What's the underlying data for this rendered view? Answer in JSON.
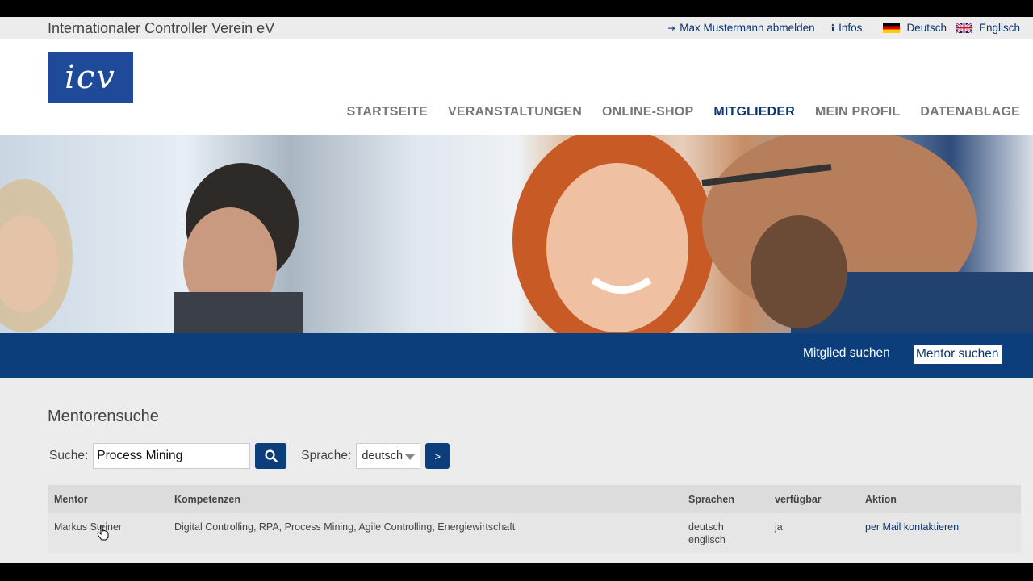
{
  "topbar": {
    "org_name": "Internationaler Controller Verein eV",
    "logout": "Max Mustermann abmelden",
    "infos": "Infos",
    "lang_de": "Deutsch",
    "lang_en": "Englisch"
  },
  "logo_text": "icv",
  "nav": [
    "STARTSEITE",
    "VERANSTALTUNGEN",
    "ONLINE-SHOP",
    "MITGLIEDER",
    "MEIN PROFIL",
    "DATENABLAGE"
  ],
  "nav_active": "MITGLIEDER",
  "subnav": {
    "member_search": "Mitglied suchen",
    "mentor_search": "Mentor suchen"
  },
  "page_title": "Mentorensuche",
  "search": {
    "label": "Suche:",
    "value": "Process Mining",
    "lang_label": "Sprache:",
    "lang_value": "deutsch",
    "go_label": ">"
  },
  "table": {
    "headers": [
      "Mentor",
      "Kompetenzen",
      "Sprachen",
      "verfügbar",
      "Aktion"
    ],
    "rows": [
      {
        "mentor": "Markus Steiner",
        "kompetenzen": "Digital Controlling, RPA, Process Mining, Agile Controlling, Energiewirtschaft",
        "sprachen_1": "deutsch",
        "sprachen_2": "englisch",
        "verfuegbar": "ja",
        "aktion": "per Mail kontaktieren"
      }
    ]
  },
  "colors": {
    "brand_blue": "#0b3e7a",
    "logo_blue": "#1f4a9a",
    "text_link": "#0b3470"
  }
}
